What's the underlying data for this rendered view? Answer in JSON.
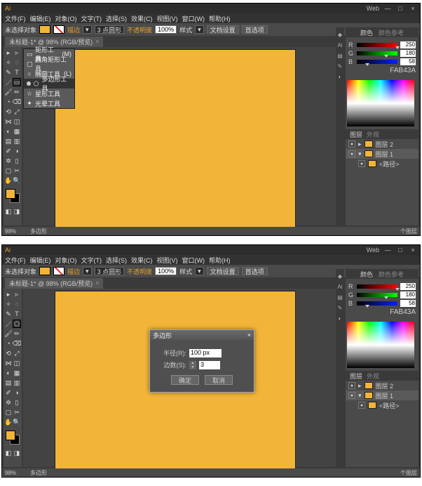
{
  "app": {
    "logo": "Ai",
    "platform_link": "Web",
    "win": {
      "min": "—",
      "max": "□",
      "close": "×"
    }
  },
  "menus": [
    "文件(F)",
    "编辑(E)",
    "对象(O)",
    "文字(T)",
    "选择(S)",
    "效果(C)",
    "视图(V)",
    "窗口(W)",
    "帮助(H)"
  ],
  "propbar": {
    "selection": "未选择对象",
    "stroke_label": "描边",
    "stroke_pt": "3 点圆形",
    "opacity_label": "不透明度",
    "opacity_value": "100%",
    "style_label": "样式",
    "docsetup": "文档设置",
    "prefs": "首选项"
  },
  "tab": {
    "title": "未标题-1* @ 98% (RGB/预览)",
    "close": "×"
  },
  "status": {
    "zoom": "98%",
    "tool": "多边形",
    "count_label": "个图层",
    "layers_button": "图层"
  },
  "flyout": {
    "items": [
      {
        "icon": "▭",
        "label": "矩形工具",
        "key": "(M)"
      },
      {
        "icon": "▢",
        "label": "圆角矩形工具",
        "key": ""
      },
      {
        "icon": "○",
        "label": "椭圆工具",
        "key": "(L)"
      },
      {
        "icon": "⬠",
        "label": "多边形工具",
        "key": ""
      },
      {
        "icon": "☆",
        "label": "星形工具",
        "key": ""
      },
      {
        "icon": "✦",
        "label": "光晕工具",
        "key": ""
      }
    ],
    "selected_index": 3
  },
  "color": {
    "tab1": "颜色",
    "tab2": "颜色参考",
    "channels": [
      {
        "lbl": "R",
        "val": "250",
        "grad": "linear-gradient(to right,#000,#f00)",
        "pos": 94
      },
      {
        "lbl": "G",
        "val": "180",
        "grad": "linear-gradient(to right,#000,#0f0)",
        "pos": 68
      },
      {
        "lbl": "B",
        "val": "58",
        "grad": "linear-gradient(to right,#000,#02f)",
        "pos": 20
      }
    ],
    "hex": "FAB43A"
  },
  "layers": {
    "tab1": "图层",
    "tab2": "外观",
    "rows": [
      {
        "eye": "●",
        "label": "图层 2",
        "thumb": "#f2b539"
      },
      {
        "eye": "●",
        "label": "图层 1",
        "thumb": "#f2b539"
      },
      {
        "eye": "●",
        "label": "<路径>",
        "thumb": "#f2b539"
      }
    ]
  },
  "dialog": {
    "title": "多边形",
    "radius_label": "半径(R):",
    "radius_value": "100 px",
    "sides_label": "边数(S):",
    "sides_value": "3",
    "ok": "确定",
    "cancel": "取消",
    "close": "×"
  }
}
